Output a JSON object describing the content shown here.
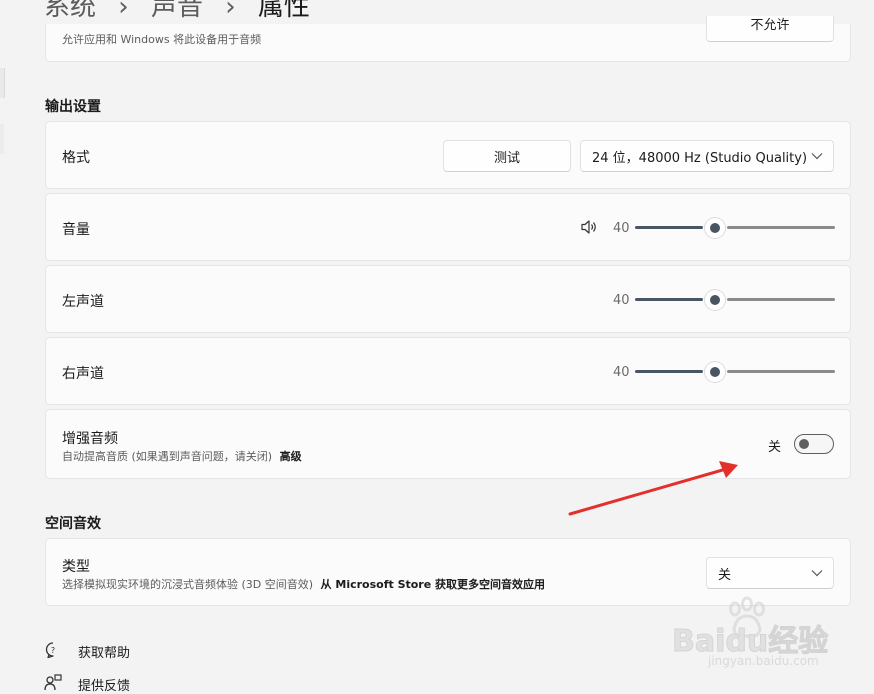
{
  "breadcrumb": {
    "part1": "系统",
    "part2": "声音",
    "part3": "属性",
    "separator": "›"
  },
  "top_card": {
    "description": "允许应用和 Windows 将此设备用于音频",
    "button_label": "不允许"
  },
  "output_settings": {
    "title": "输出设置",
    "format": {
      "label": "格式",
      "test_button": "测试",
      "selected_format": "24 位，48000 Hz (Studio Quality)"
    },
    "volume": {
      "label": "音量",
      "value": "40",
      "level": 0.4
    },
    "left_channel": {
      "label": "左声道",
      "value": "40",
      "level": 0.4
    },
    "right_channel": {
      "label": "右声道",
      "value": "40",
      "level": 0.4
    },
    "enhance_audio": {
      "label": "增强音频",
      "description": "自动提高音质 (如果遇到声音问题，请关闭)",
      "advanced_link": "高级",
      "state_label": "关",
      "on": false
    }
  },
  "spatial_audio": {
    "title": "空间音效",
    "type": {
      "label": "类型",
      "description": "选择模拟现实环境的沉浸式音频体验 (3D 空间音效)",
      "store_link": "从 Microsoft Store 获取更多空间音效应用",
      "selected": "关"
    }
  },
  "footer": {
    "help": "获取帮助",
    "feedback": "提供反馈"
  },
  "watermark": {
    "text": "Baidu经验",
    "url_text": "jingyan.baidu.com"
  },
  "colors": {
    "accent": "#4a5563",
    "arrow": "#e2312d",
    "background": "#f3f3f3"
  }
}
